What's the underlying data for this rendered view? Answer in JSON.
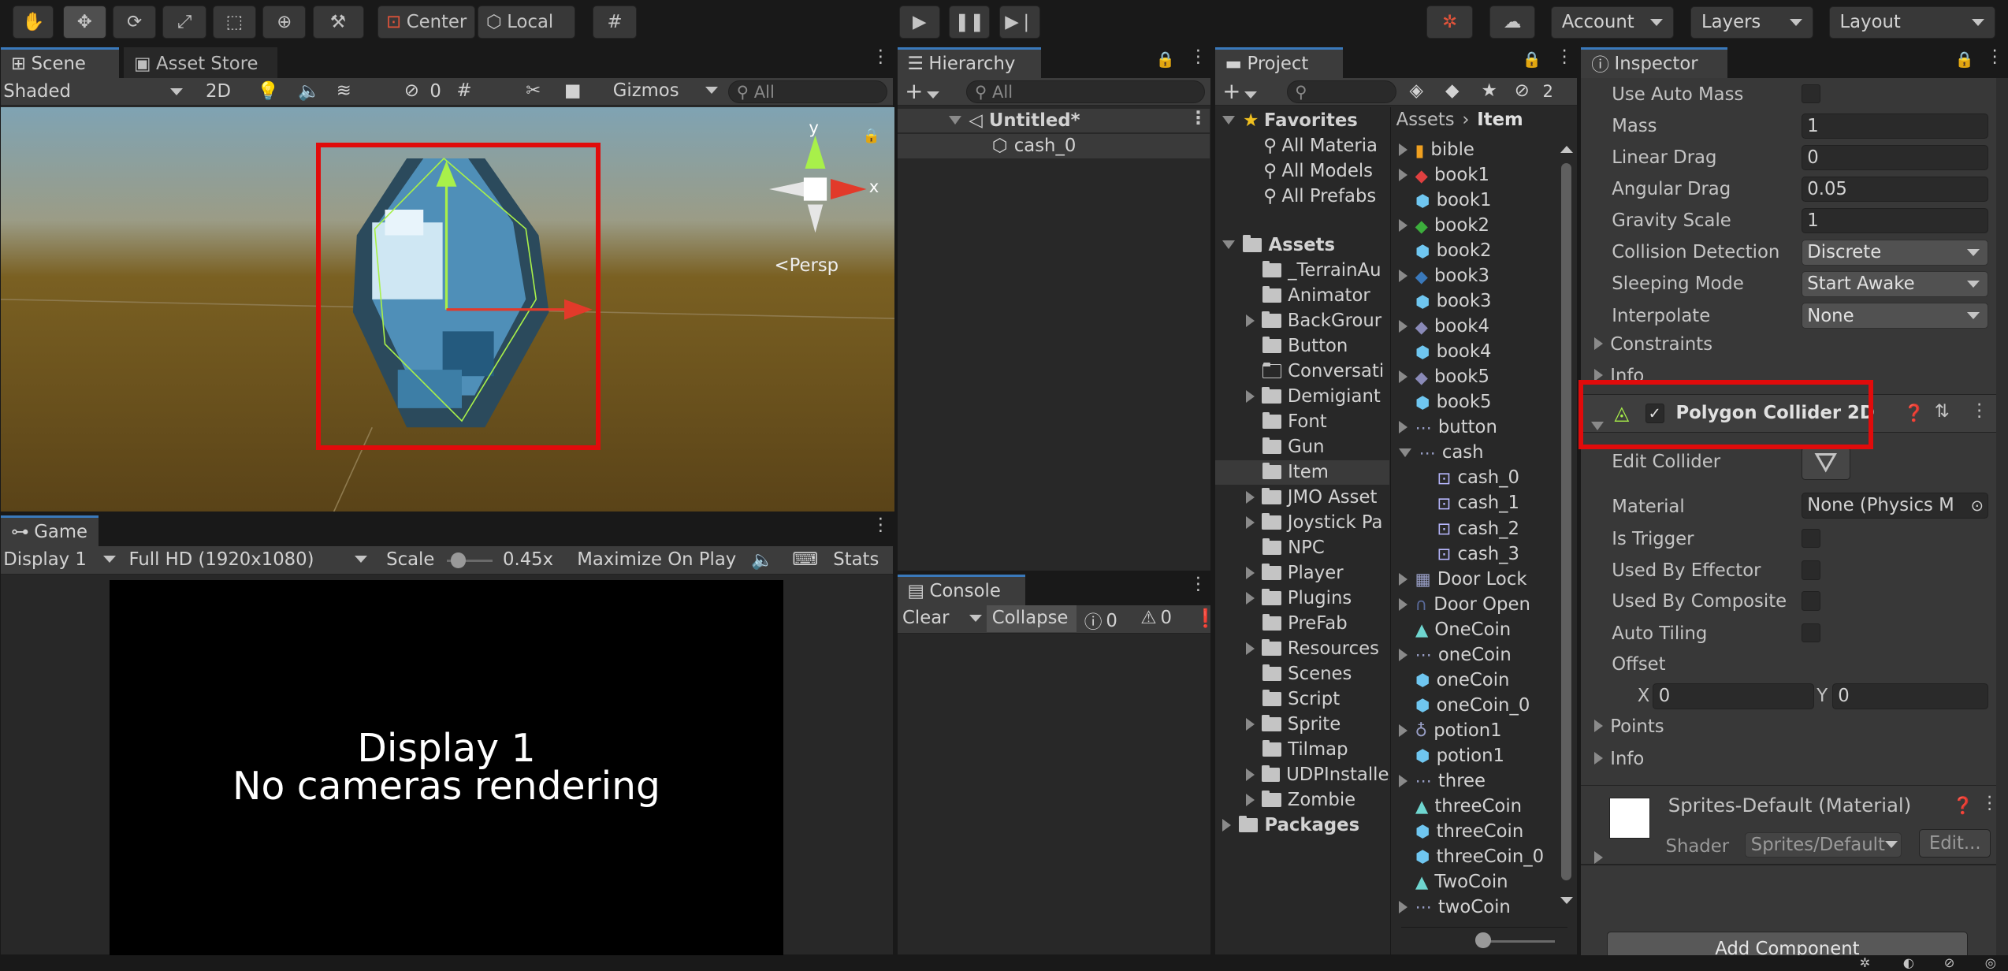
{
  "toolbar": {
    "center": "Center",
    "local": "Local",
    "account": "Account",
    "layers": "Layers",
    "layout": "Layout"
  },
  "scene": {
    "tabs": [
      "Scene",
      "Asset Store"
    ],
    "shading": "Shaded",
    "mode_2d": "2D",
    "hidden_count": "0",
    "gizmos": "Gizmos",
    "search_placeholder": "All",
    "persp": "Persp",
    "axis_y": "y",
    "axis_x": "x"
  },
  "game": {
    "tab": "Game",
    "display": "Display 1",
    "resolution": "Full HD (1920x1080)",
    "scale_label": "Scale",
    "scale_value": "0.45x",
    "scale_fraction": 0.2,
    "maximize": "Maximize On Play",
    "stats": "Stats",
    "message_line1": "Display 1",
    "message_line2": "No cameras rendering"
  },
  "hierarchy": {
    "tab": "Hierarchy",
    "search_placeholder": "All",
    "scene_name": "Untitled*",
    "object": "cash_0"
  },
  "console": {
    "tab": "Console",
    "clear": "Clear",
    "collapse": "Collapse",
    "errors": "0",
    "warnings": "0"
  },
  "project": {
    "tab": "Project",
    "hidden_count": "2",
    "favorites": "Favorites",
    "fav_items": [
      "All Materia",
      "All Models",
      "All Prefabs"
    ],
    "assets": "Assets",
    "packages": "Packages",
    "folders": [
      "_TerrainAu",
      "Animator",
      "BackGrour",
      "Button",
      "Conversati",
      "Demigiant",
      "Font",
      "Gun",
      "Item",
      "JMO Asset",
      "Joystick Pa",
      "NPC",
      "Player",
      "Plugins",
      "PreFab",
      "Resources",
      "Scenes",
      "Script",
      "Sprite",
      "Tilmap",
      "UDPInstalle",
      "Zombie"
    ],
    "breadcrumb_root": "Assets",
    "breadcrumb_sep": "›",
    "breadcrumb_current": "Item",
    "files": [
      "bible",
      "book1",
      "book1",
      "book2",
      "book2",
      "book3",
      "book3",
      "book4",
      "book4",
      "book5",
      "book5",
      "button",
      "cash",
      "cash_0",
      "cash_1",
      "cash_2",
      "cash_3",
      "Door Lock",
      "Door Open",
      "OneCoin",
      "oneCoin",
      "oneCoin",
      "oneCoin_0",
      "potion1",
      "potion1",
      "three",
      "threeCoin",
      "threeCoin",
      "threeCoin_0",
      "TwoCoin",
      "twoCoin"
    ]
  },
  "inspector": {
    "tab": "Inspector",
    "rows": [
      {
        "label": "Use Auto Mass",
        "type": "check"
      },
      {
        "label": "Mass",
        "value": "1"
      },
      {
        "label": "Linear Drag",
        "value": "0"
      },
      {
        "label": "Angular Drag",
        "value": "0.05"
      },
      {
        "label": "Gravity Scale",
        "value": "1"
      },
      {
        "label": "Collision Detection",
        "popup": "Discrete"
      },
      {
        "label": "Sleeping Mode",
        "popup": "Start Awake"
      },
      {
        "label": "Interpolate",
        "popup": "None"
      }
    ],
    "constraints": "Constraints",
    "info_cut": "Info",
    "component": "Polygon Collider 2D",
    "edit_collider": "Edit Collider",
    "material_label": "Material",
    "material_value": "None (Physics M",
    "is_trigger": "Is Trigger",
    "used_by_effector": "Used By Effector",
    "used_by_composite": "Used By Composite",
    "auto_tiling": "Auto Tiling",
    "offset": "Offset",
    "offset_x_label": "X",
    "offset_x": "0",
    "offset_y_label": "Y",
    "offset_y": "0",
    "points": "Points",
    "info": "Info",
    "material_name": "Sprites-Default (Material)",
    "shader_label": "Shader",
    "shader_value": "Sprites/Default",
    "edit": "Edit...",
    "add_component": "Add Component"
  }
}
